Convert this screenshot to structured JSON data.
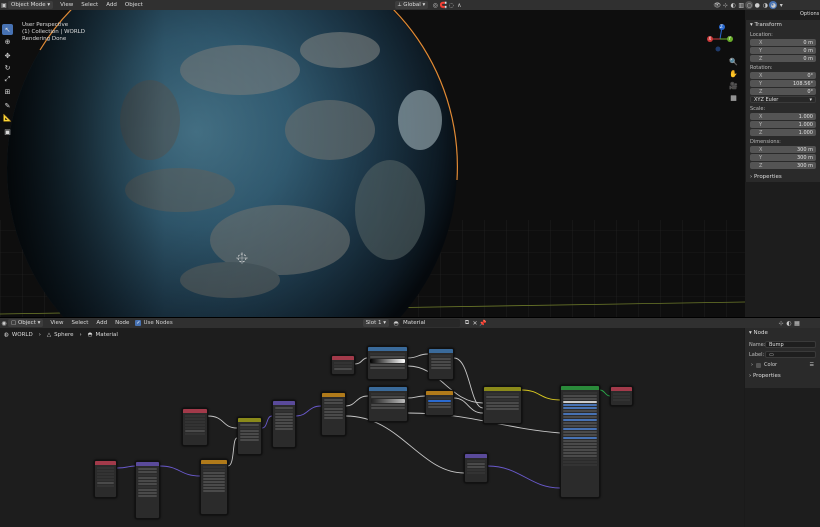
{
  "top_header": {
    "mode": "Object Mode",
    "menus": [
      "View",
      "Select",
      "Add",
      "Object"
    ],
    "orientation": "Global",
    "options": "Options"
  },
  "viewport": {
    "overlay_lines": [
      "User Perspective",
      "(1) Collection | WORLD",
      "Rendering Done"
    ],
    "gizmo": {
      "z": "Z",
      "y": "Y",
      "x": "X"
    }
  },
  "transform_panel": {
    "title": "Transform",
    "location_label": "Location:",
    "location": [
      {
        "axis": "X",
        "value": "0 m"
      },
      {
        "axis": "Y",
        "value": "0 m"
      },
      {
        "axis": "Z",
        "value": "0 m"
      }
    ],
    "rotation_label": "Rotation:",
    "rotation": [
      {
        "axis": "X",
        "value": "0°"
      },
      {
        "axis": "Y",
        "value": "108.56°"
      },
      {
        "axis": "Z",
        "value": "0°"
      }
    ],
    "rotation_mode": "XYZ Euler",
    "scale_label": "Scale:",
    "scale": [
      {
        "axis": "X",
        "value": "1.000"
      },
      {
        "axis": "Y",
        "value": "1.000"
      },
      {
        "axis": "Z",
        "value": "1.000"
      }
    ],
    "dimensions_label": "Dimensions:",
    "dimensions": [
      {
        "axis": "X",
        "value": "300 m"
      },
      {
        "axis": "Y",
        "value": "300 m"
      },
      {
        "axis": "Z",
        "value": "300 m"
      }
    ],
    "properties": "Properties"
  },
  "node_header": {
    "object": "Object",
    "menus": [
      "View",
      "Select",
      "Add",
      "Node"
    ],
    "use_nodes": "Use Nodes",
    "slot": "Slot 1",
    "material": "Material"
  },
  "breadcrumb": [
    "WORLD",
    "Sphere",
    "Material"
  ],
  "node_panel": {
    "title": "Node",
    "name_label": "Name:",
    "name_value": "Bump",
    "label_label": "Label:",
    "color": "Color",
    "properties": "Properties"
  },
  "colors": {
    "header_bg": "#303030",
    "panel_bg": "#2a2a2a",
    "field_bg": "#545454",
    "accent": "#4772b3",
    "node_red": "#a23a4a",
    "node_purple": "#5a4a9a",
    "node_yellow": "#8a8a1a",
    "node_blue": "#3a6a9a",
    "node_green": "#2a8a3a",
    "node_orange": "#b07a1a"
  }
}
